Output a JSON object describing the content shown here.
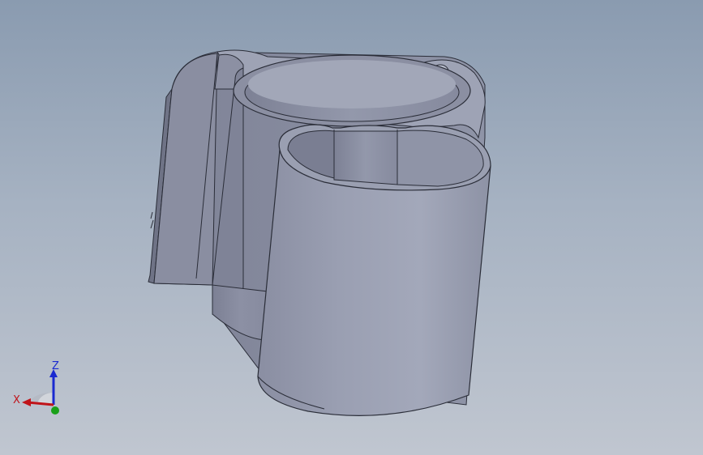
{
  "viewport": {
    "background_top": "#8a9bb0",
    "background_bottom": "#c0c6d0"
  },
  "model": {
    "description_icon": "cup-holder-part",
    "surface_color": "#8e93a6",
    "edge_color": "#2a2d38"
  },
  "triad": {
    "x_label": "X",
    "z_label": "Z",
    "x_color": "#c0141a",
    "y_color": "#1aa01a",
    "z_color": "#1a2ad0"
  }
}
